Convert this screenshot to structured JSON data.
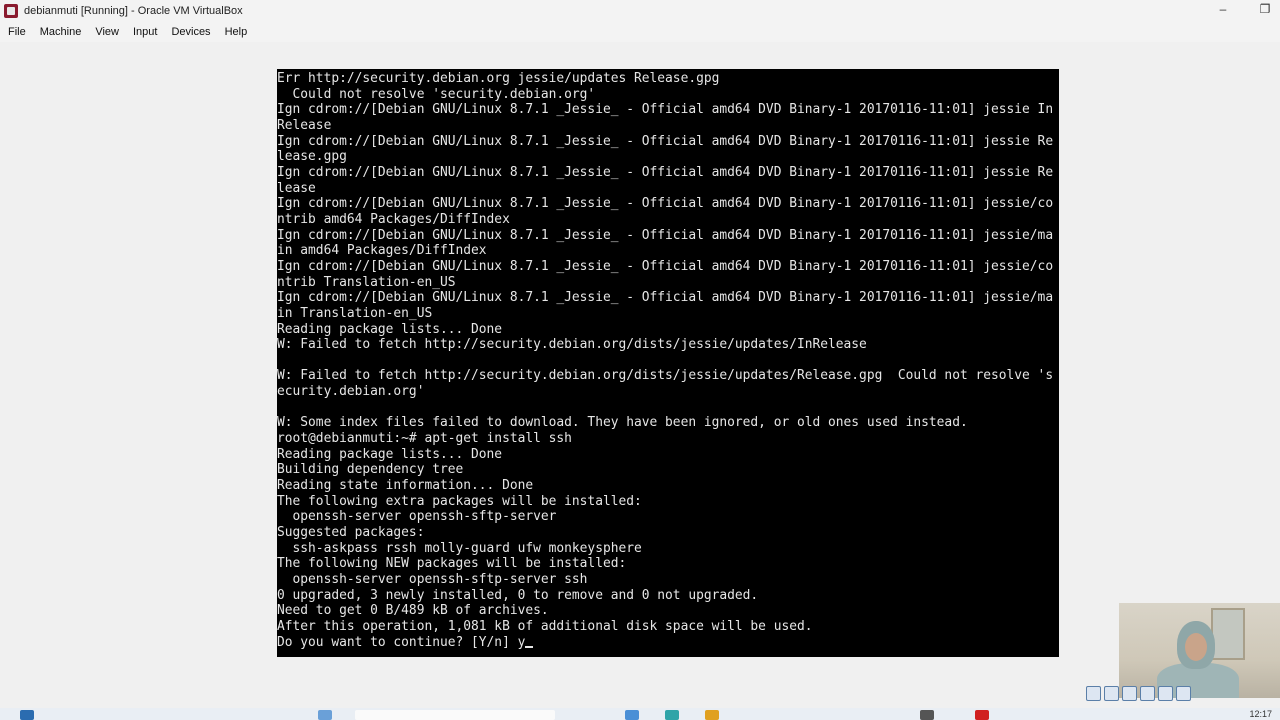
{
  "window": {
    "title": "debianmuti [Running] - Oracle VM VirtualBox",
    "controls": {
      "minimize": "–",
      "restore": "❐"
    }
  },
  "menu": [
    "File",
    "Machine",
    "View",
    "Input",
    "Devices",
    "Help"
  ],
  "terminal": {
    "lines": [
      "Err http://security.debian.org jessie/updates Release.gpg",
      "  Could not resolve 'security.debian.org'",
      "Ign cdrom://[Debian GNU/Linux 8.7.1 _Jessie_ - Official amd64 DVD Binary-1 20170116-11:01] jessie In",
      "Release",
      "Ign cdrom://[Debian GNU/Linux 8.7.1 _Jessie_ - Official amd64 DVD Binary-1 20170116-11:01] jessie Re",
      "lease.gpg",
      "Ign cdrom://[Debian GNU/Linux 8.7.1 _Jessie_ - Official amd64 DVD Binary-1 20170116-11:01] jessie Re",
      "lease",
      "Ign cdrom://[Debian GNU/Linux 8.7.1 _Jessie_ - Official amd64 DVD Binary-1 20170116-11:01] jessie/co",
      "ntrib amd64 Packages/DiffIndex",
      "Ign cdrom://[Debian GNU/Linux 8.7.1 _Jessie_ - Official amd64 DVD Binary-1 20170116-11:01] jessie/ma",
      "in amd64 Packages/DiffIndex",
      "Ign cdrom://[Debian GNU/Linux 8.7.1 _Jessie_ - Official amd64 DVD Binary-1 20170116-11:01] jessie/co",
      "ntrib Translation-en_US",
      "Ign cdrom://[Debian GNU/Linux 8.7.1 _Jessie_ - Official amd64 DVD Binary-1 20170116-11:01] jessie/ma",
      "in Translation-en_US",
      "Reading package lists... Done",
      "W: Failed to fetch http://security.debian.org/dists/jessie/updates/InRelease",
      "",
      "W: Failed to fetch http://security.debian.org/dists/jessie/updates/Release.gpg  Could not resolve 's",
      "ecurity.debian.org'",
      "",
      "W: Some index files failed to download. They have been ignored, or old ones used instead.",
      "root@debianmuti:~# apt-get install ssh",
      "Reading package lists... Done",
      "Building dependency tree",
      "Reading state information... Done",
      "The following extra packages will be installed:",
      "  openssh-server openssh-sftp-server",
      "Suggested packages:",
      "  ssh-askpass rssh molly-guard ufw monkeysphere",
      "The following NEW packages will be installed:",
      "  openssh-server openssh-sftp-server ssh",
      "0 upgraded, 3 newly installed, 0 to remove and 0 not upgraded.",
      "Need to get 0 B/489 kB of archives.",
      "After this operation, 1,081 kB of additional disk space will be used.",
      "Do you want to continue? [Y/n] y"
    ]
  },
  "taskbar": {
    "time": "12:17"
  }
}
